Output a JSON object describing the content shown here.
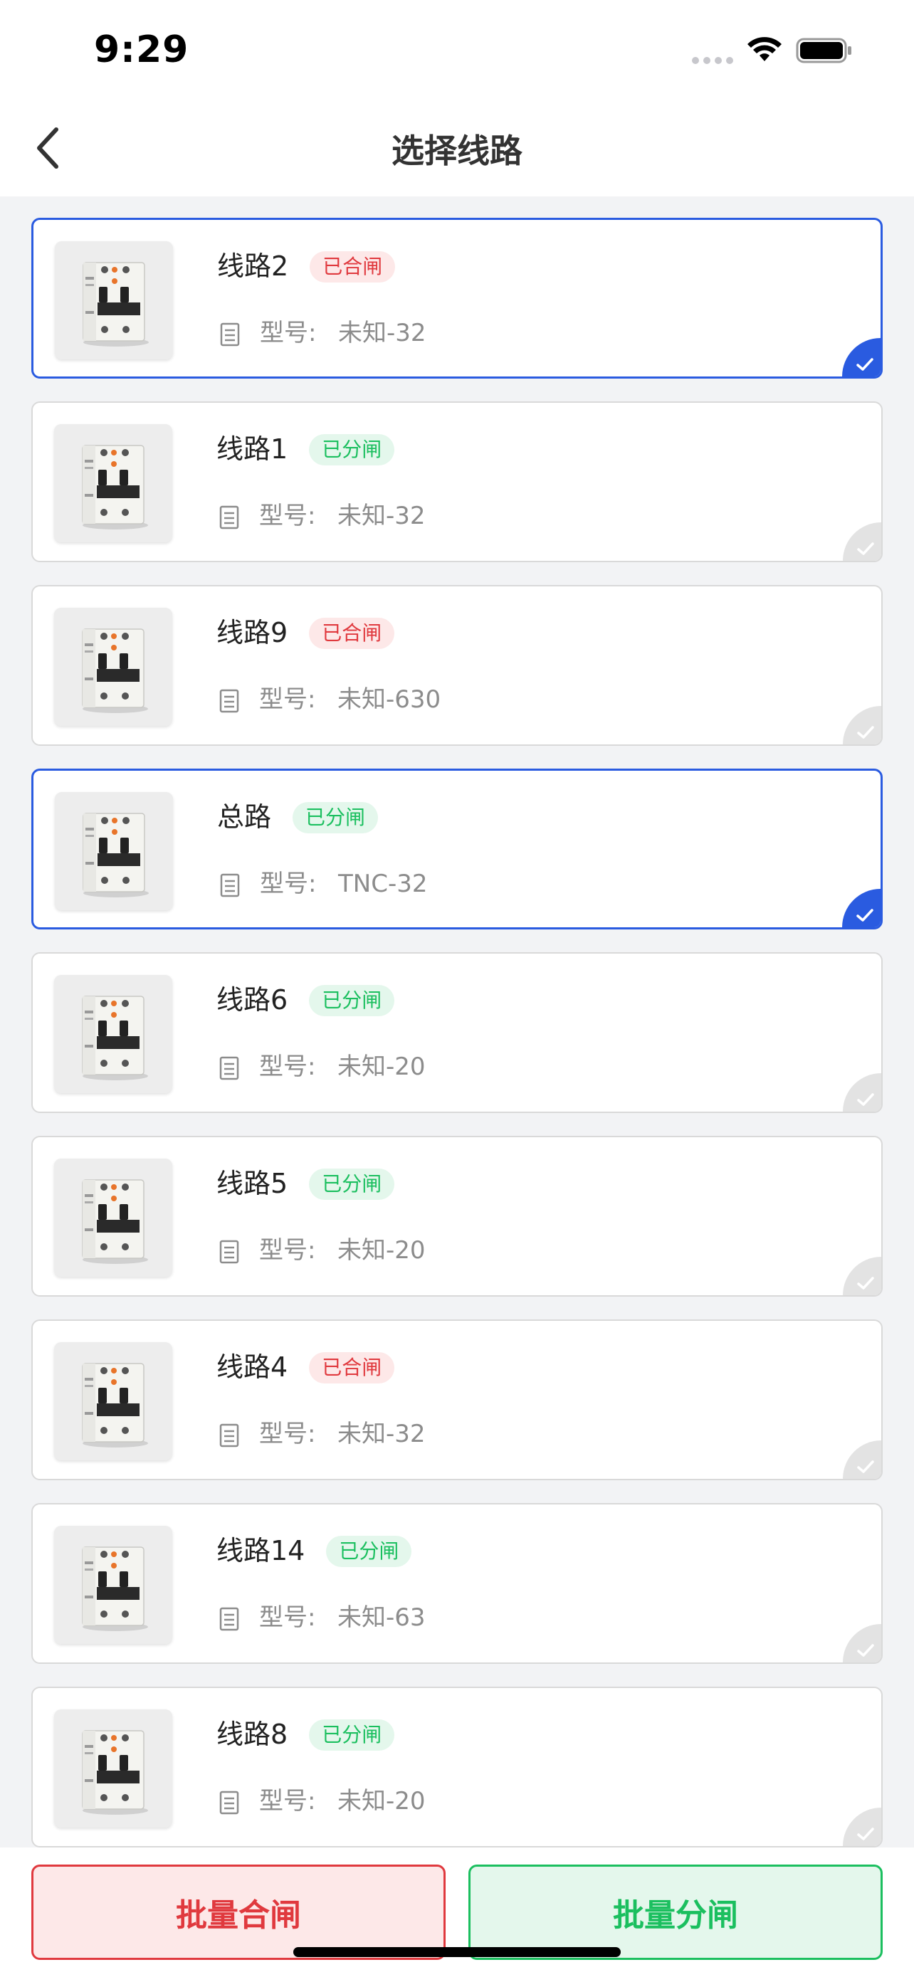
{
  "status_bar": {
    "time": "9:29"
  },
  "nav": {
    "title": "选择线路"
  },
  "model_prefix": "型号:",
  "circuits": [
    {
      "name": "线路2",
      "status": "已合闸",
      "status_type": "closed",
      "model": "未知-32",
      "selected": true
    },
    {
      "name": "线路1",
      "status": "已分闸",
      "status_type": "open",
      "model": "未知-32",
      "selected": false
    },
    {
      "name": "线路9",
      "status": "已合闸",
      "status_type": "closed",
      "model": "未知-630",
      "selected": false
    },
    {
      "name": "总路",
      "status": "已分闸",
      "status_type": "open",
      "model": "TNC-32",
      "selected": true
    },
    {
      "name": "线路6",
      "status": "已分闸",
      "status_type": "open",
      "model": "未知-20",
      "selected": false
    },
    {
      "name": "线路5",
      "status": "已分闸",
      "status_type": "open",
      "model": "未知-20",
      "selected": false
    },
    {
      "name": "线路4",
      "status": "已合闸",
      "status_type": "closed",
      "model": "未知-32",
      "selected": false
    },
    {
      "name": "线路14",
      "status": "已分闸",
      "status_type": "open",
      "model": "未知-63",
      "selected": false
    },
    {
      "name": "线路8",
      "status": "已分闸",
      "status_type": "open",
      "model": "未知-20",
      "selected": false
    }
  ],
  "actions": {
    "batch_close_label": "批量合闸",
    "batch_open_label": "批量分闸"
  },
  "colors": {
    "accent": "#2A5BE0",
    "closed": "#E0393E",
    "open": "#1BBF5F"
  }
}
